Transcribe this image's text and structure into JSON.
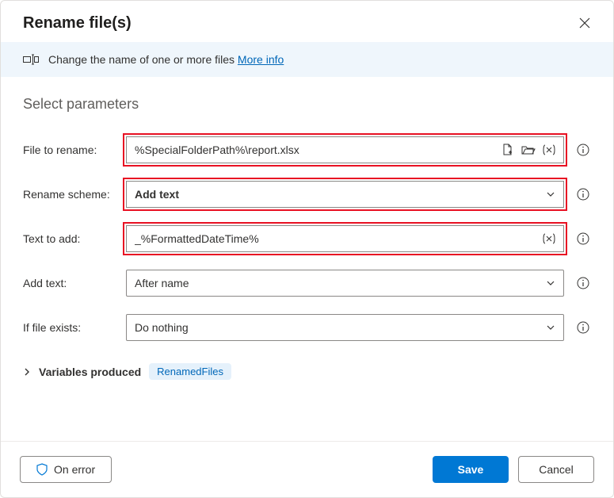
{
  "header": {
    "title": "Rename file(s)"
  },
  "banner": {
    "text": "Change the name of one or more files ",
    "link": "More info"
  },
  "section_title": "Select parameters",
  "fields": {
    "file_to_rename": {
      "label": "File to rename:",
      "value": "%SpecialFolderPath%\\report.xlsx"
    },
    "rename_scheme": {
      "label": "Rename scheme:",
      "value": "Add text"
    },
    "text_to_add": {
      "label": "Text to add:",
      "value": "_%FormattedDateTime%"
    },
    "add_text": {
      "label": "Add text:",
      "value": "After name"
    },
    "if_file_exists": {
      "label": "If file exists:",
      "value": "Do nothing"
    }
  },
  "variables": {
    "label": "Variables produced",
    "chip": "RenamedFiles"
  },
  "footer": {
    "on_error": "On error",
    "save": "Save",
    "cancel": "Cancel"
  }
}
